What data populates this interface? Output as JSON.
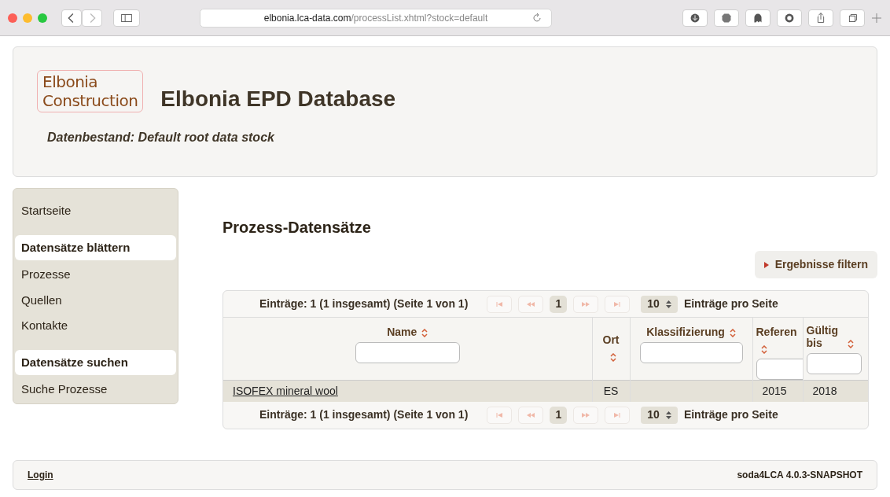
{
  "browser": {
    "url_host": "elbonia.lca-data.com",
    "url_path": "/processList.xhtml?stock=default"
  },
  "header": {
    "logo_lines": [
      "Elbonia",
      "Construction"
    ],
    "title": "Elbonia EPD Database",
    "data_stock": "Datenbestand: Default root data stock"
  },
  "sidebar": {
    "items": [
      {
        "kind": "link",
        "label": "Startseite"
      },
      {
        "kind": "section",
        "label": "Datensätze blättern"
      },
      {
        "kind": "link",
        "label": "Prozesse"
      },
      {
        "kind": "link",
        "label": "Quellen"
      },
      {
        "kind": "link",
        "label": "Kontakte"
      },
      {
        "kind": "section",
        "label": "Datensätze suchen"
      },
      {
        "kind": "link",
        "label": "Suche Prozesse"
      }
    ]
  },
  "page_title": "Prozess-Datensätze",
  "filter_button": "Ergebnisse filtern",
  "table": {
    "pagers": [
      {
        "summary": "Einträge: 1 (1 insgesamt) (Seite 1 von 1)",
        "page": "1",
        "per_page": "10",
        "per_page_label": "Einträge pro Seite"
      },
      {
        "summary": "Einträge: 1 (1 insgesamt) (Seite 1 von 1)",
        "page": "1",
        "per_page": "10",
        "per_page_label": "Einträge pro Seite"
      }
    ],
    "columns": [
      {
        "label": "Name",
        "filter": true
      },
      {
        "label": "Ort",
        "filter": false
      },
      {
        "label": "Klassifizierung",
        "filter": true
      },
      {
        "label": "Referen",
        "filter": true
      },
      {
        "label": "Gültig bis",
        "filter": true
      }
    ],
    "rows": [
      [
        "ISOFEX mineral wool",
        "ES",
        "",
        "2015",
        "2018"
      ]
    ]
  },
  "footer": {
    "login": "Login",
    "version": "soda4LCA 4.0.3-SNAPSHOT"
  }
}
